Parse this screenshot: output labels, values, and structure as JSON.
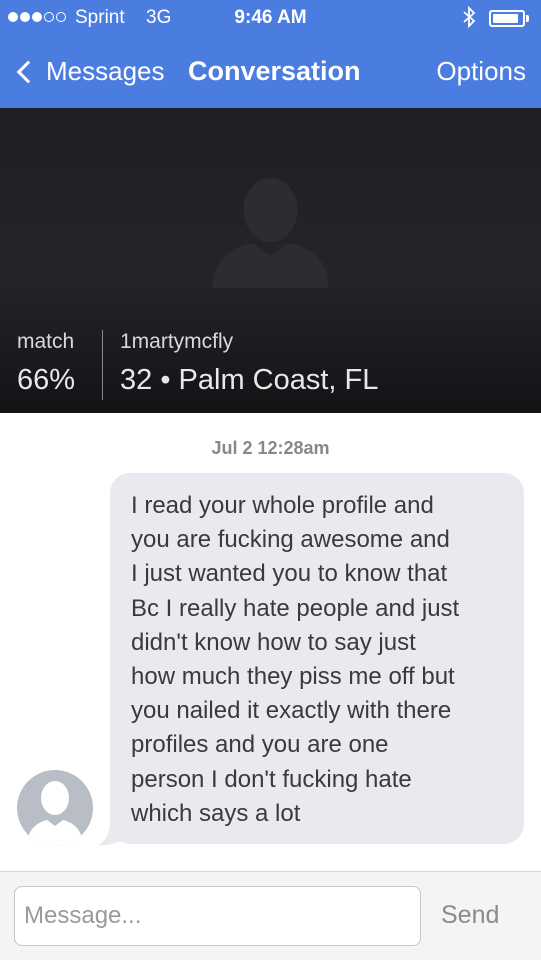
{
  "status_bar": {
    "carrier": "Sprint",
    "network": "3G",
    "time": "9:46 AM",
    "signal_bars": 3,
    "signal_max": 5,
    "battery_level": 0.9
  },
  "nav": {
    "back_label": "Messages",
    "title": "Conversation",
    "options_label": "Options",
    "color": "#4b7de0"
  },
  "profile": {
    "match_label": "match",
    "match_value": "66%",
    "username": "1martymcfly",
    "age_location": "32 • Palm Coast, FL"
  },
  "conversation": {
    "timestamp": "Jul 2 12:28am",
    "messages": [
      {
        "lines": [
          "I read your whole profile and",
          "you are fucking awesome and",
          "I just wanted you to know that",
          "Bc I really hate people and just",
          "didn't know how to say just",
          "how much they piss me off but",
          "you nailed it exactly with there",
          "profiles and you are one",
          "person I don't fucking hate",
          "which says a lot"
        ]
      }
    ]
  },
  "composer": {
    "placeholder": "Message...",
    "send_label": "Send"
  },
  "icons": {
    "back": "chevron-left-icon",
    "bluetooth": "bluetooth-icon",
    "battery": "battery-icon",
    "profile_photo": "person-silhouette-icon",
    "avatar": "person-silhouette-icon"
  }
}
